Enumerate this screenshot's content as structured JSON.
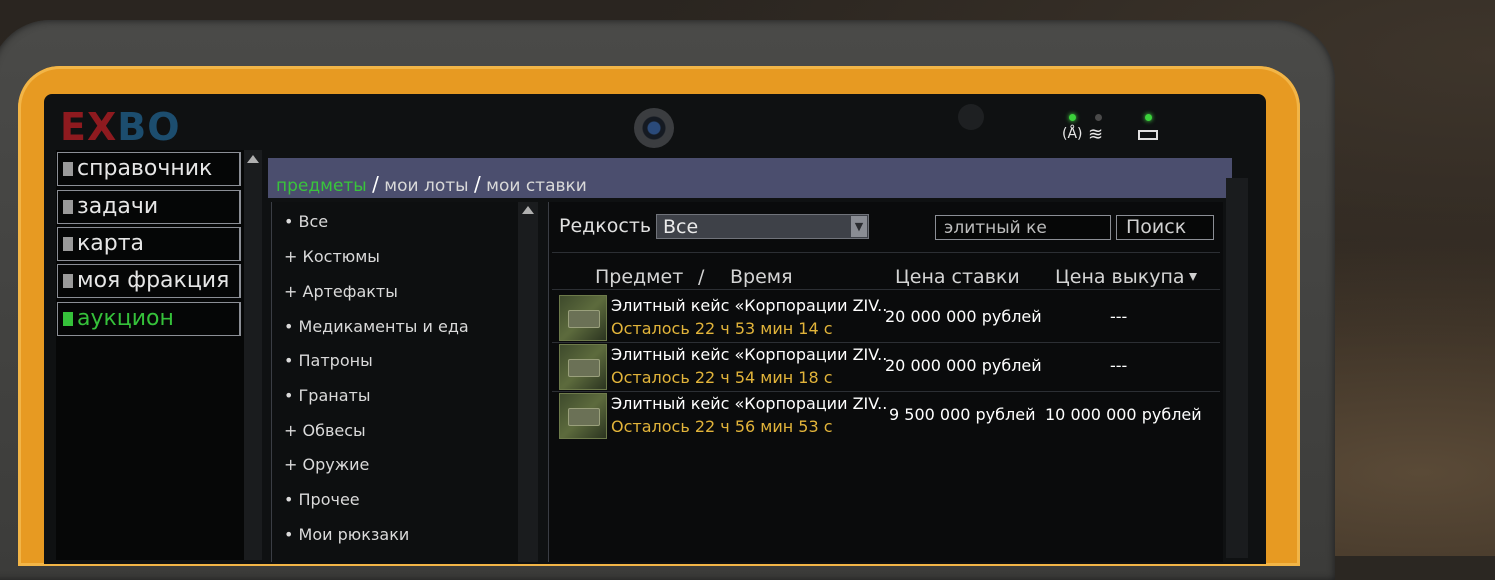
{
  "logo": {
    "part1": "EX",
    "part2": "BO"
  },
  "status": {
    "signal_icon": "signal-icon",
    "wifi_icon": "wifi-icon",
    "battery_icon": "battery-icon"
  },
  "nav": {
    "items": [
      {
        "label": "справочник"
      },
      {
        "label": "задачи"
      },
      {
        "label": "карта"
      },
      {
        "label": "моя фракция"
      },
      {
        "label": "аукцион",
        "active": true
      }
    ]
  },
  "tabs": {
    "items": [
      "предметы",
      "мои лоты",
      "мои ставки"
    ],
    "separator": "/",
    "active": "предметы"
  },
  "categories": [
    {
      "label": "• Все"
    },
    {
      "label": "+ Костюмы"
    },
    {
      "label": "+ Артефакты"
    },
    {
      "label": "• Медикаменты и еда"
    },
    {
      "label": "• Патроны"
    },
    {
      "label": "• Гранаты"
    },
    {
      "label": "+ Обвесы"
    },
    {
      "label": "+ Оружие"
    },
    {
      "label": "• Прочее"
    },
    {
      "label": "• Мои рюкзаки"
    }
  ],
  "filter": {
    "rarity_label": "Редкость",
    "rarity_value": "Все",
    "search_value": "элитный ке",
    "search_button": "Поиск"
  },
  "table": {
    "headers": {
      "item": "Предмет",
      "sep": "/",
      "time": "Время",
      "bid": "Цена ставки",
      "buyout": "Цена выкупа"
    },
    "rows": [
      {
        "name": "Элитный кейс «Корпорации ZIV..",
        "time_left": "Осталось 22 ч 53 мин 14 с",
        "bid": "20 000 000 рублей",
        "buyout": "---"
      },
      {
        "name": "Элитный кейс «Корпорации ZIV..",
        "time_left": "Осталось 22 ч 54 мин 18 с",
        "bid": "20 000 000 рублей",
        "buyout": "---"
      },
      {
        "name": "Элитный кейс «Корпорации ZIV..",
        "time_left": "Осталось 22 ч 56 мин 53 с",
        "bid": "9 500 000 рублей",
        "buyout": "10 000 000 рублей"
      }
    ]
  },
  "colors": {
    "bezel": "#e79a22",
    "active_green": "#35c13a",
    "tab_bar": "#4b4e6e",
    "time_left": "#e2b43a"
  }
}
